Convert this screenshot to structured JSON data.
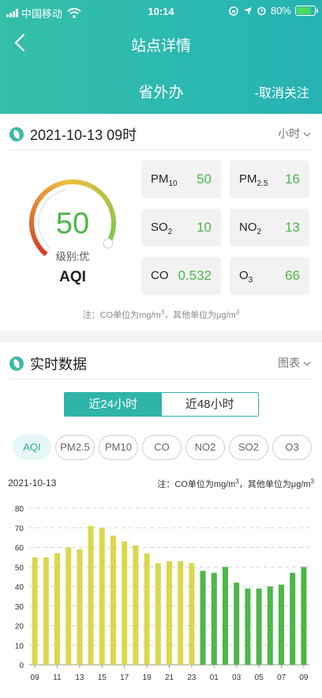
{
  "status": {
    "carrier": "中国移动",
    "time": "10:14",
    "battery": "80%"
  },
  "nav": {
    "title": "站点详情",
    "station": "省外办",
    "unfollow": "-取消关注"
  },
  "summary": {
    "datetime": "2021-10-13 09时",
    "period": "小时",
    "aqi": "50",
    "level": "级别:优",
    "aqi_label": "AQI",
    "gauge_fraction": 0.5,
    "pollutants": [
      {
        "name": "PM",
        "sub": "10",
        "value": "50"
      },
      {
        "name": "PM",
        "sub": "2.5",
        "value": "16"
      },
      {
        "name": "SO",
        "sub": "2",
        "value": "10"
      },
      {
        "name": "NO",
        "sub": "2",
        "value": "13"
      },
      {
        "name": "CO",
        "sub": "",
        "value": "0.532"
      },
      {
        "name": "O",
        "sub": "3",
        "value": "66"
      }
    ],
    "note_pre": "注：CO单位为mg/m",
    "note_mid": "，其他单位为μg/m",
    "note_sup": "3"
  },
  "realtime": {
    "title": "实时数据",
    "view": "图表",
    "ranges": [
      "近24小时",
      "近48小时"
    ],
    "pills": [
      "AQI",
      "PM2.5",
      "PM10",
      "CO",
      "NO2",
      "SO2",
      "O3"
    ],
    "date": "2021-10-13",
    "note_pre": "注：CO单位为mg/m",
    "note_mid": "，其他单位为μg/m",
    "note_sup": "3"
  },
  "colors": {
    "accent": "#2fb4a9",
    "good": "#4cb848",
    "moderate": "#d9d84e"
  },
  "chart_data": {
    "type": "bar",
    "x": [
      "09",
      "10",
      "11",
      "12",
      "13",
      "14",
      "15",
      "16",
      "17",
      "18",
      "19",
      "20",
      "21",
      "22",
      "23",
      "00",
      "01",
      "02",
      "03",
      "04",
      "05",
      "06",
      "07",
      "08",
      "09"
    ],
    "xticks": [
      "09",
      "11",
      "13",
      "15",
      "17",
      "19",
      "21",
      "23",
      "01",
      "03",
      "05",
      "07",
      "09"
    ],
    "values": [
      55,
      55,
      57,
      60,
      59,
      71,
      70,
      66,
      63,
      61,
      57,
      52,
      53,
      53,
      52,
      48,
      47,
      50,
      42,
      39,
      39,
      40,
      41,
      47,
      50
    ],
    "ylim": [
      0,
      80
    ],
    "yticks": [
      0,
      10,
      20,
      30,
      40,
      50,
      60,
      70,
      80
    ],
    "grid": true
  }
}
